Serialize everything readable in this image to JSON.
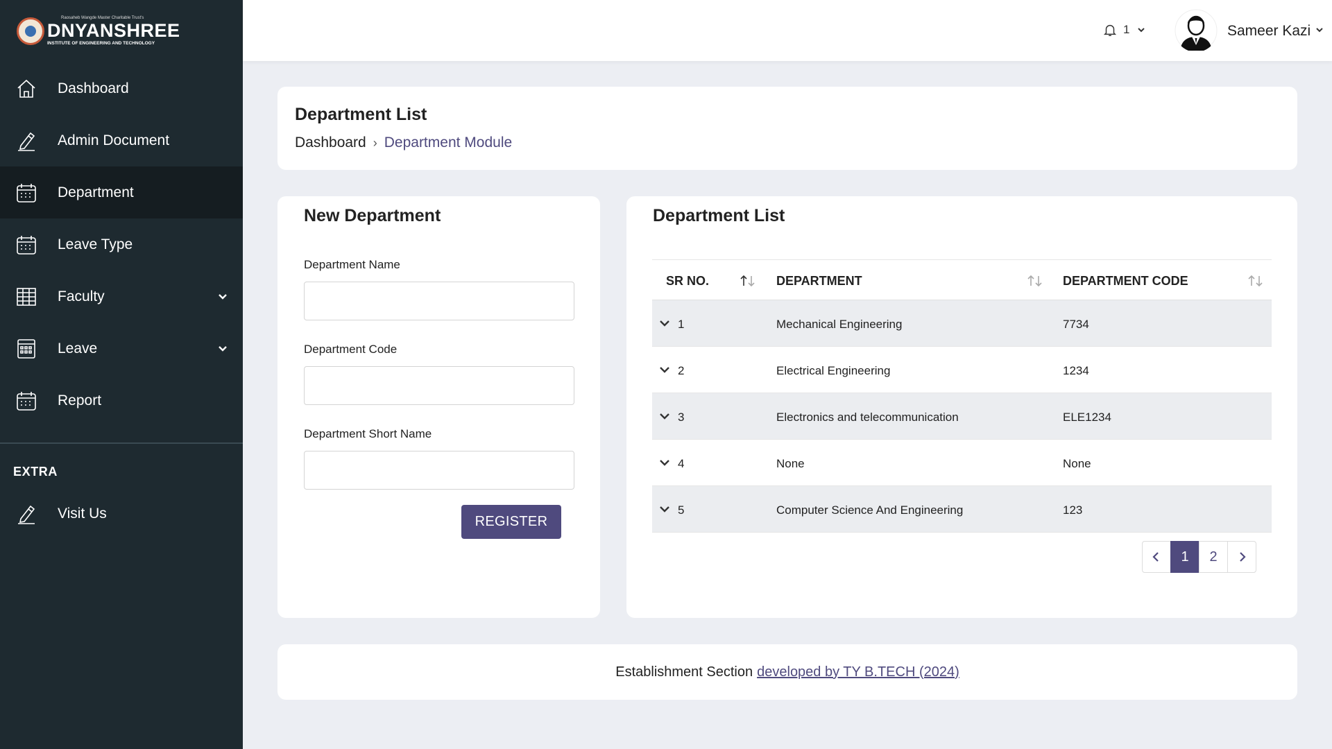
{
  "brand": {
    "trust_line": "Raosaheb Wangde Master Charitable Trust's",
    "name": "DNYANSHREE",
    "subtitle": "INSTITUTE OF ENGINEERING AND TECHNOLOGY"
  },
  "sidebar": {
    "items": [
      {
        "label": "Dashboard",
        "icon": "home-icon"
      },
      {
        "label": "Admin Document",
        "icon": "pencil-icon"
      },
      {
        "label": "Department",
        "icon": "calendar-icon",
        "active": true
      },
      {
        "label": "Leave Type",
        "icon": "calendar-icon"
      },
      {
        "label": "Faculty",
        "icon": "grid-icon",
        "expandable": true
      },
      {
        "label": "Leave",
        "icon": "calendar-grid-icon",
        "expandable": true
      },
      {
        "label": "Report",
        "icon": "calendar-icon"
      }
    ],
    "extra_heading": "EXTRA",
    "extra_items": [
      {
        "label": "Visit Us",
        "icon": "pencil-icon"
      }
    ]
  },
  "header": {
    "notification_count": "1",
    "user_name": "Sameer Kazi"
  },
  "page": {
    "title": "Department List",
    "breadcrumb": {
      "root": "Dashboard",
      "current": "Department Module"
    }
  },
  "form": {
    "title": "New Department",
    "fields": [
      {
        "label": "Department Name",
        "value": "",
        "placeholder": ""
      },
      {
        "label": "Department Code",
        "value": "",
        "placeholder": ""
      },
      {
        "label": "Department Short Name",
        "value": "",
        "placeholder": ""
      }
    ],
    "submit_label": "REGISTER"
  },
  "list": {
    "title": "Department List",
    "columns": [
      "SR NO.",
      "DEPARTMENT",
      "DEPARTMENT CODE"
    ],
    "rows": [
      {
        "sr": "1",
        "department": "Mechanical Engineering",
        "code": "7734"
      },
      {
        "sr": "2",
        "department": "Electrical Engineering",
        "code": "1234"
      },
      {
        "sr": "3",
        "department": "Electronics and telecommunication",
        "code": "ELE1234"
      },
      {
        "sr": "4",
        "department": "None",
        "code": "None"
      },
      {
        "sr": "5",
        "department": "Computer Science And Engineering",
        "code": "123"
      }
    ],
    "pagination": {
      "pages": [
        "1",
        "2"
      ],
      "current": "1"
    }
  },
  "footer": {
    "text": "Establishment Section",
    "link_text": "developed by TY B.TECH (2024)"
  },
  "colors": {
    "sidebar_bg": "#1e2a30",
    "sidebar_active": "#151d21",
    "accent": "#4f4a7e",
    "page_bg": "#eceef3",
    "row_stripe": "#ebedf0"
  }
}
